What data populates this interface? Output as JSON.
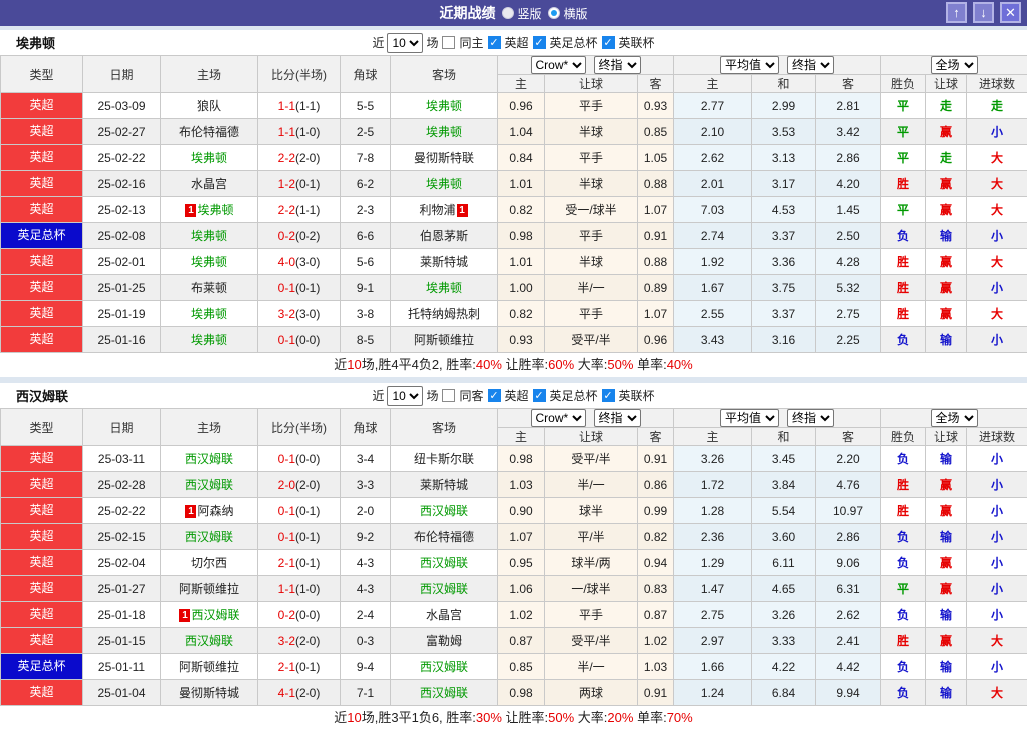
{
  "titlebar": {
    "title": "近期战绩",
    "radio_vertical": "竖版",
    "radio_horizontal": "横版",
    "up_button": "↑",
    "down_button": "↓",
    "close_button": "✕"
  },
  "colors": {
    "titlebar_bg": "#4a4a99",
    "league_red": "#f23c3c",
    "league_blue": "#0a0acc",
    "team_green": "#009900",
    "score_red": "#e60000",
    "result_red": "#e60000",
    "result_green": "#009900",
    "result_blue": "#1414cc",
    "handicap_cell_bg": "#fdf6ec",
    "odds_cell_bg": "#ecf5fa"
  },
  "shared": {
    "filter": {
      "near_label": "近",
      "count_value": "10",
      "games_label": "场",
      "leagues": [
        "英超",
        "英足总杯",
        "英联杯"
      ]
    },
    "dropdowns": {
      "company": "Crow*",
      "final1": "终指",
      "average": "平均值",
      "final2": "终指",
      "fulltime": "全场"
    },
    "columns": {
      "type": "类型",
      "date": "日期",
      "home": "主场",
      "score": "比分(半场)",
      "corner": "角球",
      "away": "客场",
      "h_home": "主",
      "h_line": "让球",
      "h_away": "客",
      "e_home": "主",
      "e_draw": "和",
      "e_away": "客",
      "r_result": "胜负",
      "r_handicap": "让球",
      "r_goals": "进球数"
    },
    "league_colors": {
      "英超": "#f23c3c",
      "英足总杯": "#0a0acc"
    },
    "result_colors": {
      "胜": "#e60000",
      "平": "#009900",
      "负": "#1414cc",
      "赢": "#e60000",
      "输": "#1414cc",
      "走": "#009900",
      "大": "#e60000",
      "小": "#1414cc"
    }
  },
  "tables": [
    {
      "team": "埃弗顿",
      "same_label": "同主",
      "same_checked": false,
      "rows": [
        {
          "lg": "英超",
          "d": "25-03-09",
          "h": "狼队",
          "hg": false,
          "hc": false,
          "s": "1-1",
          "hs": "(1-1)",
          "c": "5-5",
          "a": "埃弗顿",
          "ag": true,
          "ac": false,
          "o1": "0.96",
          "o2": "平手",
          "o3": "0.93",
          "e1": "2.77",
          "e2": "2.99",
          "e3": "2.81",
          "r1": "平",
          "r2": "走",
          "r3": "走"
        },
        {
          "lg": "英超",
          "d": "25-02-27",
          "h": "布伦特福德",
          "hg": false,
          "hc": false,
          "s": "1-1",
          "hs": "(1-0)",
          "c": "2-5",
          "a": "埃弗顿",
          "ag": true,
          "ac": false,
          "o1": "1.04",
          "o2": "半球",
          "o3": "0.85",
          "e1": "2.10",
          "e2": "3.53",
          "e3": "3.42",
          "r1": "平",
          "r2": "赢",
          "r3": "小"
        },
        {
          "lg": "英超",
          "d": "25-02-22",
          "h": "埃弗顿",
          "hg": true,
          "hc": false,
          "s": "2-2",
          "hs": "(2-0)",
          "c": "7-8",
          "a": "曼彻斯特联",
          "ag": false,
          "ac": false,
          "o1": "0.84",
          "o2": "平手",
          "o3": "1.05",
          "e1": "2.62",
          "e2": "3.13",
          "e3": "2.86",
          "r1": "平",
          "r2": "走",
          "r3": "大"
        },
        {
          "lg": "英超",
          "d": "25-02-16",
          "h": "水晶宫",
          "hg": false,
          "hc": false,
          "s": "1-2",
          "hs": "(0-1)",
          "c": "6-2",
          "a": "埃弗顿",
          "ag": true,
          "ac": false,
          "o1": "1.01",
          "o2": "半球",
          "o3": "0.88",
          "e1": "2.01",
          "e2": "3.17",
          "e3": "4.20",
          "r1": "胜",
          "r2": "赢",
          "r3": "大"
        },
        {
          "lg": "英超",
          "d": "25-02-13",
          "h": "埃弗顿",
          "hg": true,
          "hc": true,
          "s": "2-2",
          "hs": "(1-1)",
          "c": "2-3",
          "a": "利物浦",
          "ag": false,
          "ac": true,
          "o1": "0.82",
          "o2": "受一/球半",
          "o3": "1.07",
          "e1": "7.03",
          "e2": "4.53",
          "e3": "1.45",
          "r1": "平",
          "r2": "赢",
          "r3": "大"
        },
        {
          "lg": "英足总杯",
          "d": "25-02-08",
          "h": "埃弗顿",
          "hg": true,
          "hc": false,
          "s": "0-2",
          "hs": "(0-2)",
          "c": "6-6",
          "a": "伯恩茅斯",
          "ag": false,
          "ac": false,
          "o1": "0.98",
          "o2": "平手",
          "o3": "0.91",
          "e1": "2.74",
          "e2": "3.37",
          "e3": "2.50",
          "r1": "负",
          "r2": "输",
          "r3": "小"
        },
        {
          "lg": "英超",
          "d": "25-02-01",
          "h": "埃弗顿",
          "hg": true,
          "hc": false,
          "s": "4-0",
          "hs": "(3-0)",
          "c": "5-6",
          "a": "莱斯特城",
          "ag": false,
          "ac": false,
          "o1": "1.01",
          "o2": "半球",
          "o3": "0.88",
          "e1": "1.92",
          "e2": "3.36",
          "e3": "4.28",
          "r1": "胜",
          "r2": "赢",
          "r3": "大"
        },
        {
          "lg": "英超",
          "d": "25-01-25",
          "h": "布莱顿",
          "hg": false,
          "hc": false,
          "s": "0-1",
          "hs": "(0-1)",
          "c": "9-1",
          "a": "埃弗顿",
          "ag": true,
          "ac": false,
          "o1": "1.00",
          "o2": "半/一",
          "o3": "0.89",
          "e1": "1.67",
          "e2": "3.75",
          "e3": "5.32",
          "r1": "胜",
          "r2": "赢",
          "r3": "小"
        },
        {
          "lg": "英超",
          "d": "25-01-19",
          "h": "埃弗顿",
          "hg": true,
          "hc": false,
          "s": "3-2",
          "hs": "(3-0)",
          "c": "3-8",
          "a": "托特纳姆热刺",
          "ag": false,
          "ac": false,
          "o1": "0.82",
          "o2": "平手",
          "o3": "1.07",
          "e1": "2.55",
          "e2": "3.37",
          "e3": "2.75",
          "r1": "胜",
          "r2": "赢",
          "r3": "大"
        },
        {
          "lg": "英超",
          "d": "25-01-16",
          "h": "埃弗顿",
          "hg": true,
          "hc": false,
          "s": "0-1",
          "hs": "(0-0)",
          "c": "8-5",
          "a": "阿斯顿维拉",
          "ag": false,
          "ac": false,
          "o1": "0.93",
          "o2": "受平/半",
          "o3": "0.96",
          "e1": "3.43",
          "e2": "3.16",
          "e3": "2.25",
          "r1": "负",
          "r2": "输",
          "r3": "小"
        }
      ],
      "summary": [
        {
          "t": "近",
          "r": false
        },
        {
          "t": "10",
          "r": true
        },
        {
          "t": "场,胜4平4负2, 胜率:",
          "r": false
        },
        {
          "t": "40%",
          "r": true
        },
        {
          "t": " 让胜率:",
          "r": false
        },
        {
          "t": "60%",
          "r": true
        },
        {
          "t": " 大率:",
          "r": false
        },
        {
          "t": "50%",
          "r": true
        },
        {
          "t": " 单率:",
          "r": false
        },
        {
          "t": "40%",
          "r": true
        }
      ]
    },
    {
      "team": "西汉姆联",
      "same_label": "同客",
      "same_checked": false,
      "rows": [
        {
          "lg": "英超",
          "d": "25-03-11",
          "h": "西汉姆联",
          "hg": true,
          "hc": false,
          "s": "0-1",
          "hs": "(0-0)",
          "c": "3-4",
          "a": "纽卡斯尔联",
          "ag": false,
          "ac": false,
          "o1": "0.98",
          "o2": "受平/半",
          "o3": "0.91",
          "e1": "3.26",
          "e2": "3.45",
          "e3": "2.20",
          "r1": "负",
          "r2": "输",
          "r3": "小"
        },
        {
          "lg": "英超",
          "d": "25-02-28",
          "h": "西汉姆联",
          "hg": true,
          "hc": false,
          "s": "2-0",
          "hs": "(2-0)",
          "c": "3-3",
          "a": "莱斯特城",
          "ag": false,
          "ac": false,
          "o1": "1.03",
          "o2": "半/一",
          "o3": "0.86",
          "e1": "1.72",
          "e2": "3.84",
          "e3": "4.76",
          "r1": "胜",
          "r2": "赢",
          "r3": "小"
        },
        {
          "lg": "英超",
          "d": "25-02-22",
          "h": "阿森纳",
          "hg": false,
          "hc": true,
          "s": "0-1",
          "hs": "(0-1)",
          "c": "2-0",
          "a": "西汉姆联",
          "ag": true,
          "ac": false,
          "o1": "0.90",
          "o2": "球半",
          "o3": "0.99",
          "e1": "1.28",
          "e2": "5.54",
          "e3": "10.97",
          "r1": "胜",
          "r2": "赢",
          "r3": "小"
        },
        {
          "lg": "英超",
          "d": "25-02-15",
          "h": "西汉姆联",
          "hg": true,
          "hc": false,
          "s": "0-1",
          "hs": "(0-1)",
          "c": "9-2",
          "a": "布伦特福德",
          "ag": false,
          "ac": false,
          "o1": "1.07",
          "o2": "平/半",
          "o3": "0.82",
          "e1": "2.36",
          "e2": "3.60",
          "e3": "2.86",
          "r1": "负",
          "r2": "输",
          "r3": "小"
        },
        {
          "lg": "英超",
          "d": "25-02-04",
          "h": "切尔西",
          "hg": false,
          "hc": false,
          "s": "2-1",
          "hs": "(0-1)",
          "c": "4-3",
          "a": "西汉姆联",
          "ag": true,
          "ac": false,
          "o1": "0.95",
          "o2": "球半/两",
          "o3": "0.94",
          "e1": "1.29",
          "e2": "6.11",
          "e3": "9.06",
          "r1": "负",
          "r2": "赢",
          "r3": "小"
        },
        {
          "lg": "英超",
          "d": "25-01-27",
          "h": "阿斯顿维拉",
          "hg": false,
          "hc": false,
          "s": "1-1",
          "hs": "(1-0)",
          "c": "4-3",
          "a": "西汉姆联",
          "ag": true,
          "ac": false,
          "o1": "1.06",
          "o2": "一/球半",
          "o3": "0.83",
          "e1": "1.47",
          "e2": "4.65",
          "e3": "6.31",
          "r1": "平",
          "r2": "赢",
          "r3": "小"
        },
        {
          "lg": "英超",
          "d": "25-01-18",
          "h": "西汉姆联",
          "hg": true,
          "hc": true,
          "s": "0-2",
          "hs": "(0-0)",
          "c": "2-4",
          "a": "水晶宫",
          "ag": false,
          "ac": false,
          "o1": "1.02",
          "o2": "平手",
          "o3": "0.87",
          "e1": "2.75",
          "e2": "3.26",
          "e3": "2.62",
          "r1": "负",
          "r2": "输",
          "r3": "小"
        },
        {
          "lg": "英超",
          "d": "25-01-15",
          "h": "西汉姆联",
          "hg": true,
          "hc": false,
          "s": "3-2",
          "hs": "(2-0)",
          "c": "0-3",
          "a": "富勒姆",
          "ag": false,
          "ac": false,
          "o1": "0.87",
          "o2": "受平/半",
          "o3": "1.02",
          "e1": "2.97",
          "e2": "3.33",
          "e3": "2.41",
          "r1": "胜",
          "r2": "赢",
          "r3": "大"
        },
        {
          "lg": "英足总杯",
          "d": "25-01-11",
          "h": "阿斯顿维拉",
          "hg": false,
          "hc": false,
          "s": "2-1",
          "hs": "(0-1)",
          "c": "9-4",
          "a": "西汉姆联",
          "ag": true,
          "ac": false,
          "o1": "0.85",
          "o2": "半/一",
          "o3": "1.03",
          "e1": "1.66",
          "e2": "4.22",
          "e3": "4.42",
          "r1": "负",
          "r2": "输",
          "r3": "小"
        },
        {
          "lg": "英超",
          "d": "25-01-04",
          "h": "曼彻斯特城",
          "hg": false,
          "hc": false,
          "s": "4-1",
          "hs": "(2-0)",
          "c": "7-1",
          "a": "西汉姆联",
          "ag": true,
          "ac": false,
          "o1": "0.98",
          "o2": "两球",
          "o3": "0.91",
          "e1": "1.24",
          "e2": "6.84",
          "e3": "9.94",
          "r1": "负",
          "r2": "输",
          "r3": "大"
        }
      ],
      "summary": [
        {
          "t": "近",
          "r": false
        },
        {
          "t": "10",
          "r": true
        },
        {
          "t": "场,胜3平1负6, 胜率:",
          "r": false
        },
        {
          "t": "30%",
          "r": true
        },
        {
          "t": " 让胜率:",
          "r": false
        },
        {
          "t": "50%",
          "r": true
        },
        {
          "t": " 大率:",
          "r": false
        },
        {
          "t": "20%",
          "r": true
        },
        {
          "t": " 单率:",
          "r": false
        },
        {
          "t": "70%",
          "r": true
        }
      ]
    }
  ]
}
